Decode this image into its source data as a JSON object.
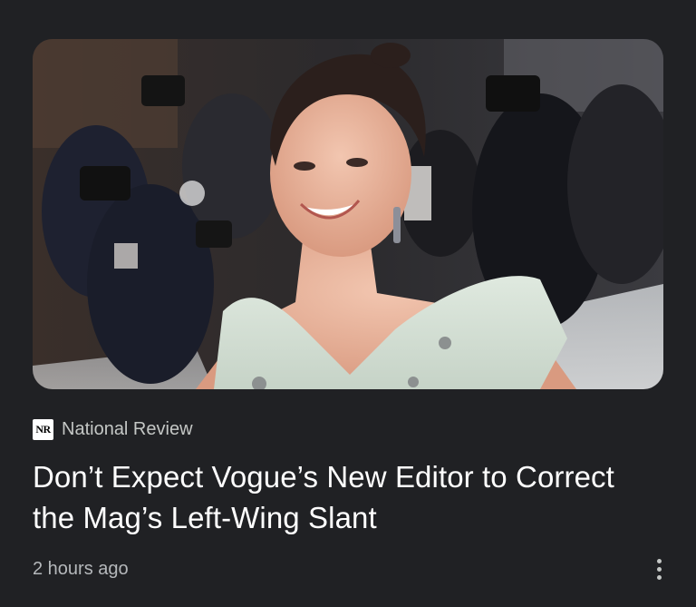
{
  "article": {
    "image_alt": "Woman in a pale sequined gown smiling in front of photographers",
    "source": {
      "logo_text": "NR",
      "name": "National Review"
    },
    "headline": "Don’t Expect Vogue’s New Editor to Correct the Mag’s Left-Wing Slant",
    "timestamp": "2 hours ago",
    "more_icon": "more-vert-icon"
  },
  "colors": {
    "background": "#202124",
    "headline": "#ffffff",
    "secondary_text": "#b5b8bb"
  }
}
